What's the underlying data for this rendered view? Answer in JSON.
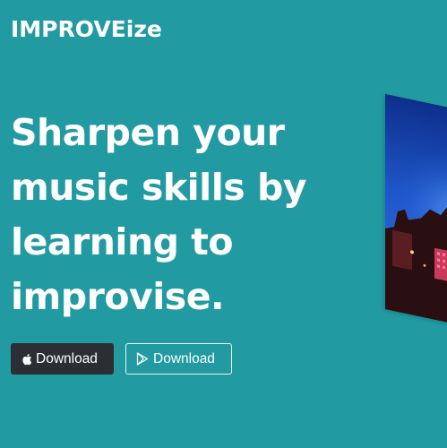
{
  "brand": {
    "name": "IMPROVEize"
  },
  "hero": {
    "headline_lines": [
      "Sharpen your",
      "music skills by",
      "learning to",
      "improvise."
    ]
  },
  "buttons": {
    "apple": {
      "label": "Download",
      "icon": "apple-icon"
    },
    "play": {
      "label": "Download",
      "icon": "google-play-icon"
    }
  },
  "colors": {
    "background": "#219aa2",
    "apple_button": "#2b2f33",
    "text": "#ffffff"
  }
}
